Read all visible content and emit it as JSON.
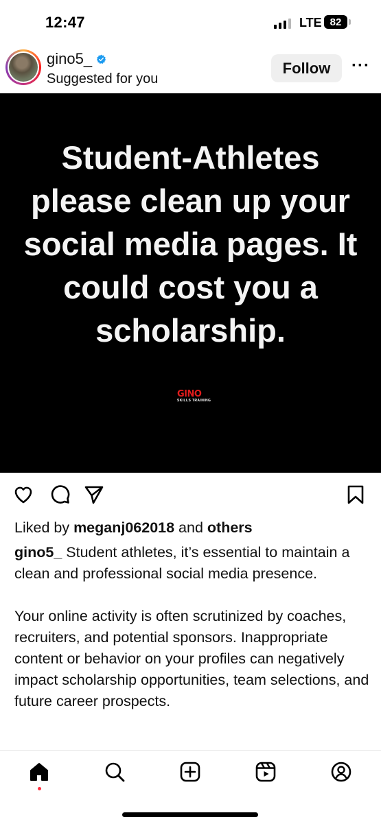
{
  "status_bar": {
    "time": "12:47",
    "network": "LTE",
    "battery": "82"
  },
  "post": {
    "username": "gino5_",
    "subtitle": "Suggested for you",
    "follow_label": "Follow",
    "more_label": "···",
    "image_text_lines": [
      "Student-Athletes",
      "please clean up your",
      "social media pages. It",
      "could cost you a",
      "scholarship."
    ],
    "logo_text": "GINO",
    "logo_subtext": "SKILLS TRAINING",
    "liked_prefix": "Liked by ",
    "liked_user": "meganj062018",
    "liked_middle": " and ",
    "liked_others": "others",
    "caption_user": "gino5_",
    "caption_p1": " Student athletes, it’s essential to maintain a clean and professional social media presence.",
    "caption_p2": "Your online activity is often scrutinized by coaches, recruiters, and potential sponsors. Inappropriate content or behavior on your profiles can negatively impact scholarship opportunities, team selections, and future career prospects."
  },
  "icons": {
    "verified": "verified-badge-icon",
    "like": "heart-icon",
    "comment": "comment-icon",
    "share": "send-icon",
    "save": "bookmark-icon",
    "nav": [
      "home-icon",
      "search-icon",
      "create-icon",
      "reels-icon",
      "profile-icon"
    ]
  },
  "colors": {
    "verified": "#1d9bf0",
    "notification_dot": "#ff3040",
    "logo_red": "#e01c1c"
  }
}
